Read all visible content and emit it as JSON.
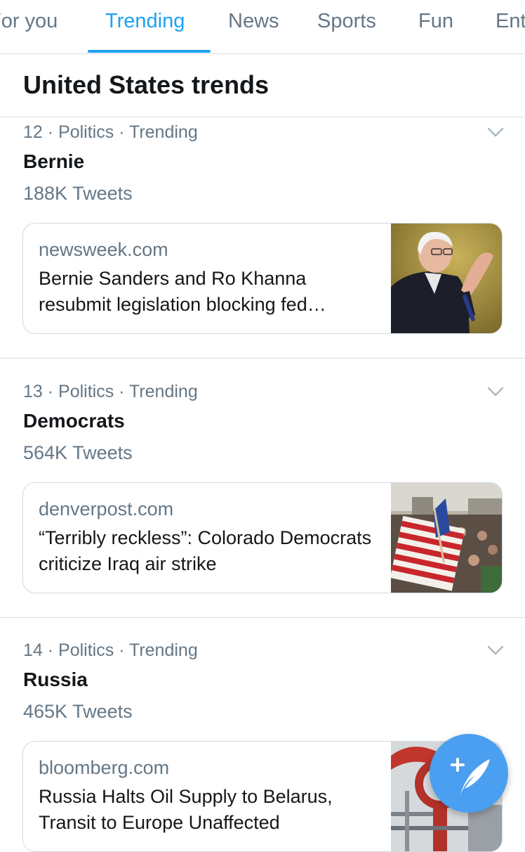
{
  "tabs": [
    {
      "label": "For you",
      "active": false
    },
    {
      "label": "Trending",
      "active": true
    },
    {
      "label": "News",
      "active": false
    },
    {
      "label": "Sports",
      "active": false
    },
    {
      "label": "Fun",
      "active": false
    },
    {
      "label": "Entertainment",
      "active": false
    }
  ],
  "section": {
    "title": "United States trends"
  },
  "trends": [
    {
      "meta": "12 · Politics · Trending",
      "name": "Bernie",
      "count": "188K Tweets",
      "card": {
        "domain": "newsweek.com",
        "headline": "Bernie Sanders and Ro Khanna resubmit legislation blocking fed…"
      }
    },
    {
      "meta": "13 · Politics · Trending",
      "name": "Democrats",
      "count": "564K Tweets",
      "card": {
        "domain": "denverpost.com",
        "headline": "“Terribly reckless”: Colorado Democrats criticize Iraq air strike"
      }
    },
    {
      "meta": "14 · Politics · Trending",
      "name": "Russia",
      "count": "465K Tweets",
      "card": {
        "domain": "bloomberg.com",
        "headline": "Russia Halts Oil Supply to Belarus, Transit to Europe Unaffected"
      }
    }
  ],
  "icons": {
    "chevron": "chevron-down-icon",
    "fab": "compose-tweet-icon"
  },
  "colors": {
    "accent": "#1da1f2",
    "secondary_text": "#657786",
    "primary_text": "#14171a",
    "fab": "#4a9ff0"
  }
}
